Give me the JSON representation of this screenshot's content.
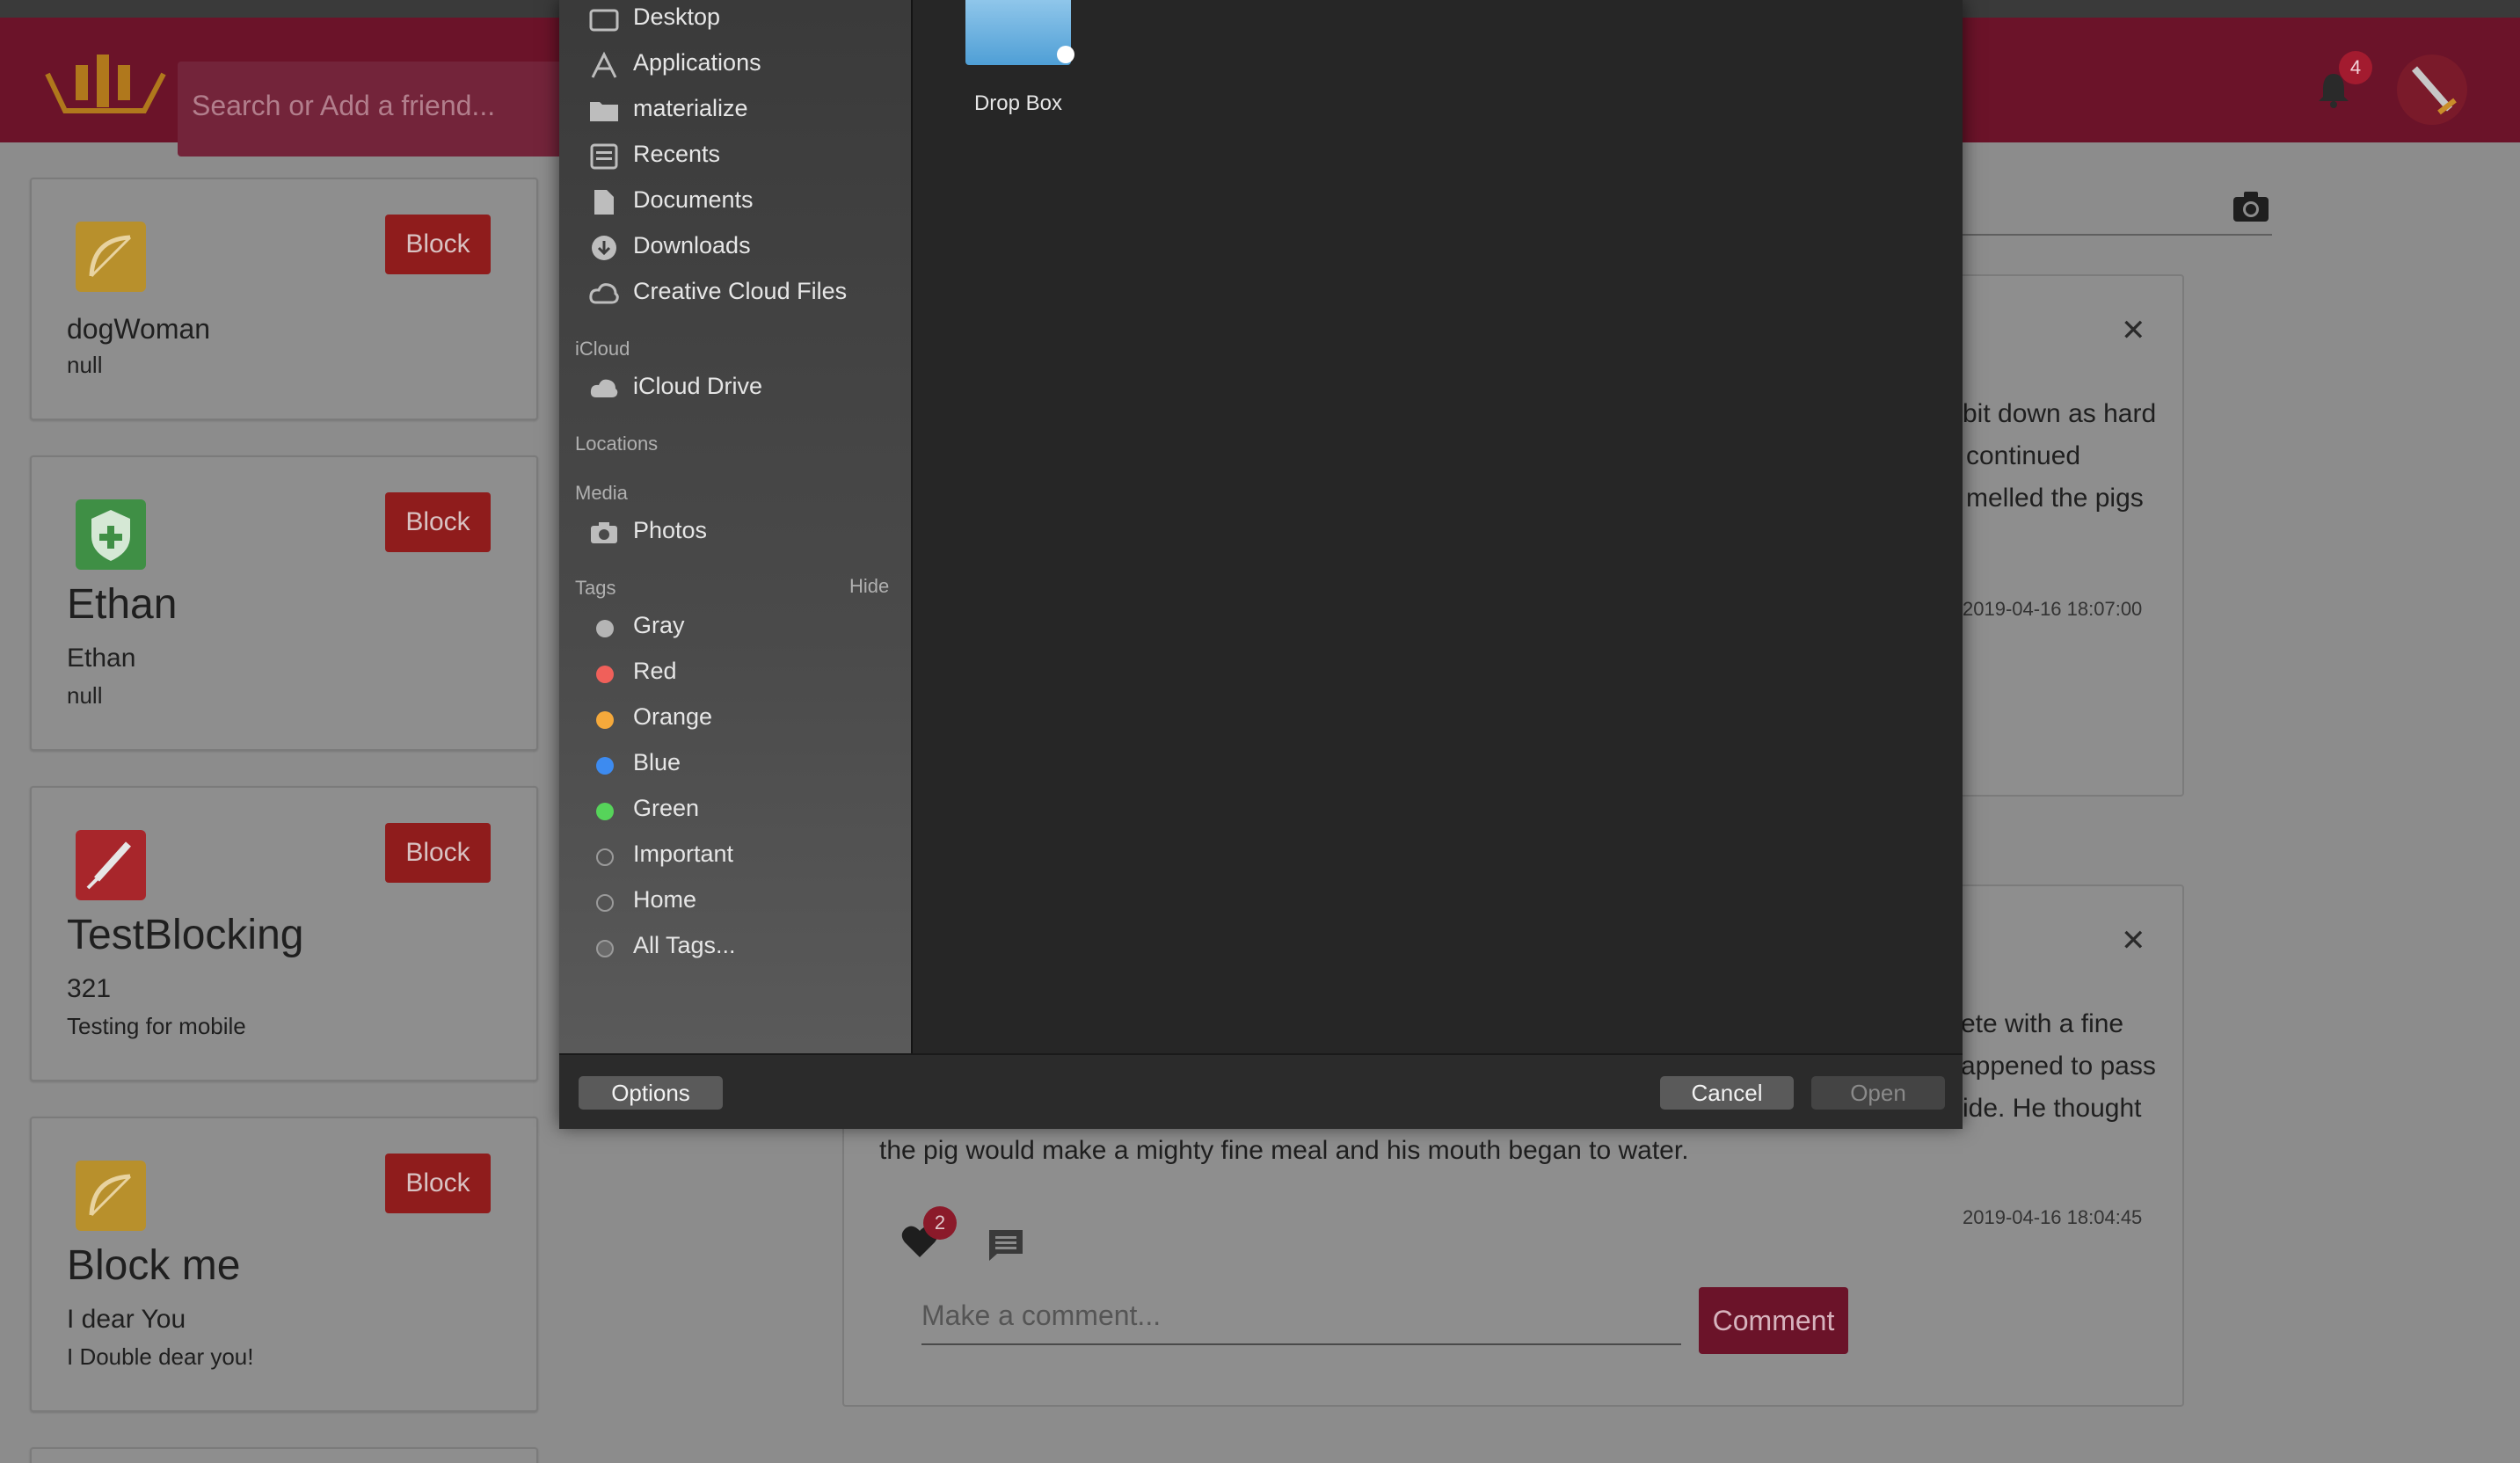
{
  "app": {
    "search_placeholder": "Search or Add a friend...",
    "notifications_count": "4"
  },
  "contacts": [
    {
      "name": "dogWoman",
      "line1": "null",
      "line2": "",
      "button": "Block",
      "icon": "bow-icon"
    },
    {
      "name": "Ethan",
      "line1": "Ethan",
      "line2": "null",
      "button": "Block",
      "icon": "shield-icon"
    },
    {
      "name": "TestBlocking",
      "line1": "321",
      "line2": "Testing for mobile",
      "button": "Block",
      "icon": "sword-icon"
    },
    {
      "name": "Block me",
      "line1": "I dear You",
      "line2": "I Double dear you!",
      "button": "Block",
      "icon": "bow-icon"
    }
  ],
  "posts": [
    {
      "lines": [
        "bit down as hard",
        "continued",
        "melled the pigs"
      ],
      "date": "2019-04-16 18:07:00"
    },
    {
      "lines": [
        "ete with a fine",
        "appened to pass",
        "ide. He thought",
        "the pig would make a mighty fine meal and his mouth began to water."
      ],
      "date": "2019-04-16 18:04:45",
      "likes": "2",
      "comment_placeholder": "Make a comment...",
      "comment_button": "Comment"
    }
  ],
  "dialog": {
    "favorites": [
      {
        "label": "Desktop",
        "icon": "desktop-icon"
      },
      {
        "label": "Applications",
        "icon": "applications-icon"
      },
      {
        "label": "materialize",
        "icon": "folder-icon"
      },
      {
        "label": "Recents",
        "icon": "recents-icon"
      },
      {
        "label": "Documents",
        "icon": "documents-icon"
      },
      {
        "label": "Downloads",
        "icon": "downloads-icon"
      },
      {
        "label": "Creative Cloud Files",
        "icon": "creative-cloud-icon"
      }
    ],
    "icloud_header": "iCloud",
    "icloud_drive": "iCloud Drive",
    "locations_header": "Locations",
    "media_header": "Media",
    "photos": "Photos",
    "tags_header": "Tags",
    "hide": "Hide",
    "tags": [
      {
        "label": "Gray",
        "color": "#b5b5b5"
      },
      {
        "label": "Red",
        "color": "#f0605a"
      },
      {
        "label": "Orange",
        "color": "#f5a93b"
      },
      {
        "label": "Blue",
        "color": "#3d8bf0"
      },
      {
        "label": "Green",
        "color": "#56d45a"
      },
      {
        "label": "Important",
        "color": ""
      },
      {
        "label": "Home",
        "color": ""
      },
      {
        "label": "All Tags...",
        "color": ""
      }
    ],
    "file_label": "Drop Box",
    "options": "Options",
    "cancel": "Cancel",
    "open": "Open"
  },
  "colors": {
    "brand": "#6b1329",
    "block_button": "#8f1c1c",
    "dialog_bg": "#252525"
  }
}
